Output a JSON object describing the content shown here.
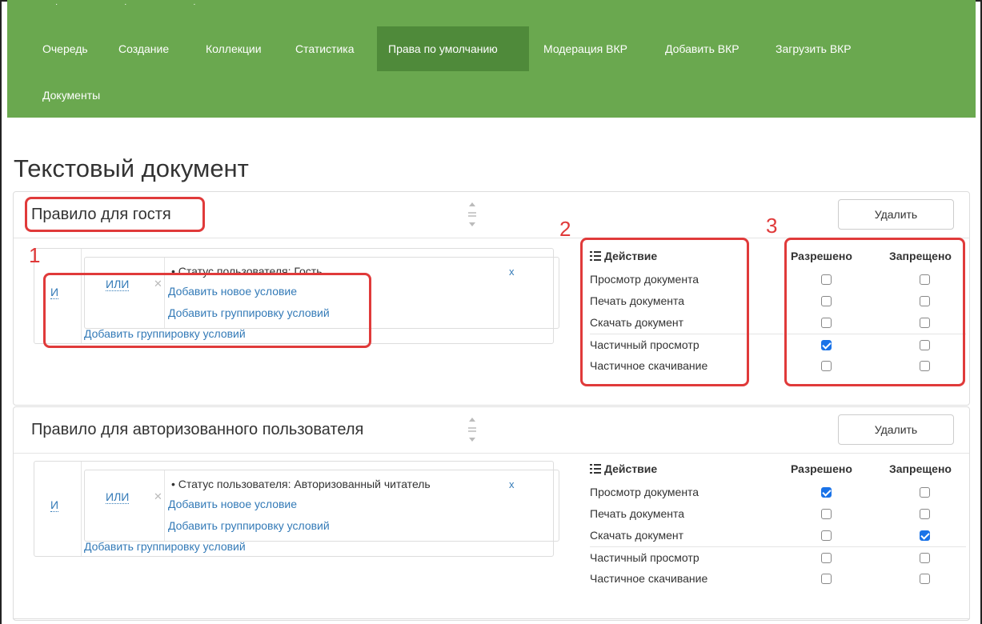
{
  "nav": {
    "items": [
      "Очередь",
      "Создание",
      "Коллекции",
      "Статистика",
      "Права по умолчанию",
      "Модерация ВКР",
      "Добавить ВКР",
      "Загрузить ВКР"
    ],
    "item_docs": "Документы",
    "active": "Права по умолчанию"
  },
  "page_title": "Текстовый документ",
  "annotations": [
    "1",
    "2",
    "3"
  ],
  "rules": [
    {
      "title": "Правило для гостя",
      "delete_label": "Удалить",
      "and_label": "И",
      "or_label": "ИЛИ",
      "condition": "•  Статус пользователя: Гость",
      "remove_x": "x",
      "add_condition": "Добавить новое условие",
      "add_group_inner": "Добавить группировку условий",
      "add_group_outer": "Добавить группировку условий",
      "action_header": "Действие",
      "allowed_header": "Разрешено",
      "denied_header": "Запрещено",
      "actions": [
        {
          "label": "Просмотр документа",
          "allowed": false,
          "denied": false
        },
        {
          "label": "Печать документа",
          "allowed": false,
          "denied": false
        },
        {
          "label": "Скачать документ",
          "allowed": false,
          "denied": false
        },
        {
          "label": "Частичный просмотр",
          "allowed": true,
          "denied": false
        },
        {
          "label": "Частичное скачивание",
          "allowed": false,
          "denied": false
        }
      ]
    },
    {
      "title": "Правило для авторизованного пользователя",
      "delete_label": "Удалить",
      "and_label": "И",
      "or_label": "ИЛИ",
      "condition": "•  Статус пользователя: Авторизованный читатель",
      "remove_x": "x",
      "add_condition": "Добавить новое условие",
      "add_group_inner": "Добавить группировку условий",
      "add_group_outer": "Добавить группировку условий",
      "action_header": "Действие",
      "allowed_header": "Разрешено",
      "denied_header": "Запрещено",
      "actions": [
        {
          "label": "Просмотр документа",
          "allowed": true,
          "denied": false
        },
        {
          "label": "Печать документа",
          "allowed": false,
          "denied": false
        },
        {
          "label": "Скачать документ",
          "allowed": false,
          "denied": true
        },
        {
          "label": "Частичный просмотр",
          "allowed": false,
          "denied": false
        },
        {
          "label": "Частичное скачивание",
          "allowed": false,
          "denied": false
        }
      ]
    }
  ],
  "colors": {
    "navbar": "#6aa84f",
    "nav_active": "#4f8a3a",
    "link": "#337ab7",
    "annotation": "#e03a3a",
    "checkbox_checked": "#1a73e8"
  }
}
